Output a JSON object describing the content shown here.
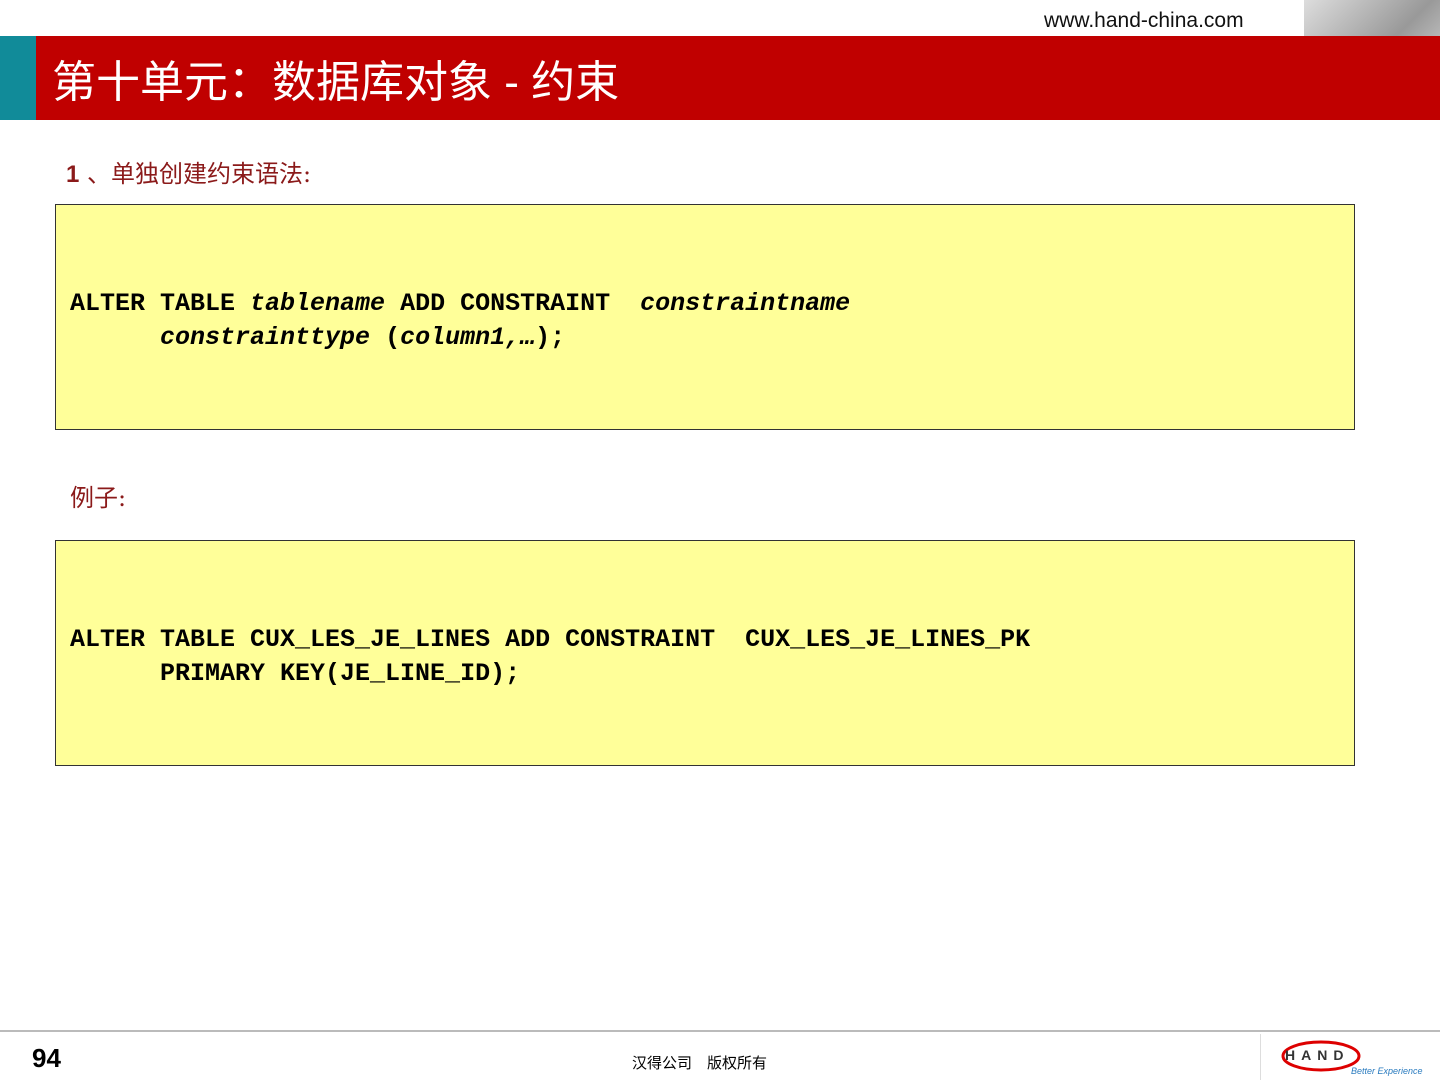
{
  "header": {
    "url": "www.hand-china.com",
    "title": "第十单元：数据库对象 - 约束"
  },
  "section": {
    "number": "1",
    "heading": "、单独创建约束语法:"
  },
  "syntax": {
    "line1_a": "ALTER TABLE ",
    "line1_b": "tablename",
    "line1_c": " ADD CONSTRAINT  ",
    "line1_d": "constraintname",
    "line2_a": "      ",
    "line2_b": "constrainttype",
    "line2_c": " (",
    "line2_d": "column1,…",
    "line2_e": ");"
  },
  "example": {
    "label": "例子:",
    "line1": "ALTER TABLE CUX_LES_JE_LINES ADD CONSTRAINT  CUX_LES_JE_LINES_PK",
    "line2": "      PRIMARY KEY(JE_LINE_ID);"
  },
  "footer": {
    "page": "94",
    "copyright": "汉得公司　版权所有",
    "logo_text": "HAND",
    "logo_tagline": "Better Experience"
  }
}
